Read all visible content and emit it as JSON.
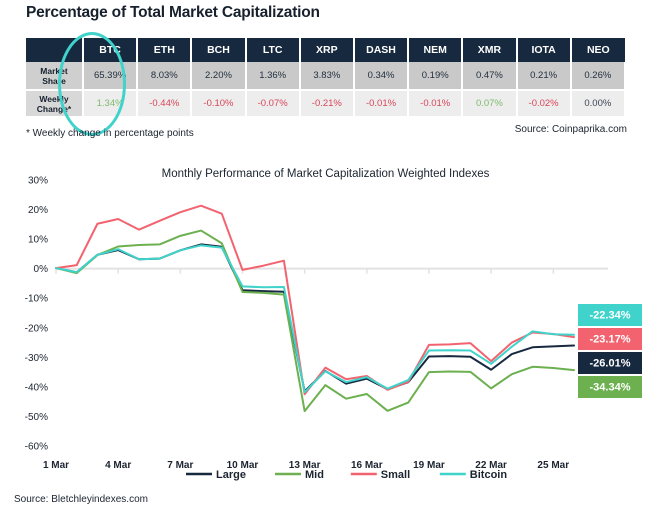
{
  "page_title": "Percentage of Total Market Capitalization",
  "table": {
    "row_header_blank": "",
    "columns": [
      "BTC",
      "ETH",
      "BCH",
      "LTC",
      "XRP",
      "DASH",
      "NEM",
      "XMR",
      "IOTA",
      "NEO"
    ],
    "rows": [
      {
        "label_line1": "Market",
        "label_line2": "Share",
        "values": [
          "65.39%",
          "8.03%",
          "2.20%",
          "1.36%",
          "3.83%",
          "0.34%",
          "0.19%",
          "0.47%",
          "0.21%",
          "0.26%"
        ],
        "signs": [
          "neutral",
          "neutral",
          "neutral",
          "neutral",
          "neutral",
          "neutral",
          "neutral",
          "neutral",
          "neutral",
          "neutral"
        ]
      },
      {
        "label_line1": "Weekly",
        "label_line2": "Change*",
        "values": [
          "1.34%",
          "-0.44%",
          "-0.10%",
          "-0.07%",
          "-0.21%",
          "-0.01%",
          "-0.01%",
          "0.07%",
          "-0.02%",
          "0.00%"
        ],
        "signs": [
          "pos",
          "neg",
          "neg",
          "neg",
          "neg",
          "neg",
          "neg",
          "pos",
          "neg",
          "zero"
        ]
      }
    ],
    "highlight_column": "BTC",
    "highlight_color": "#3fd3cb",
    "header_bg": "#17293f",
    "footnote": "* Weekly change in percentage points",
    "source": "Source: Coinpaprika.com"
  },
  "chart_data": {
    "type": "line",
    "title": "Monthly Performance of Market Capitalization Weighted Indexes",
    "xlabel": "",
    "ylabel": "",
    "ylim": [
      -60,
      30
    ],
    "ytick_labels": [
      "30%",
      "20%",
      "10%",
      "0%",
      "-10%",
      "-20%",
      "-30%",
      "-40%",
      "-50%",
      "-60%"
    ],
    "ytick_values": [
      30,
      20,
      10,
      0,
      -10,
      -20,
      -30,
      -40,
      -50,
      -60
    ],
    "xtick_labels": [
      "1 Mar",
      "4 Mar",
      "7 Mar",
      "10 Mar",
      "13 Mar",
      "16 Mar",
      "19 Mar",
      "22 Mar",
      "25 Mar"
    ],
    "xtick_indices": [
      0,
      3,
      6,
      9,
      12,
      15,
      18,
      21,
      24
    ],
    "grid": "zero-line-only",
    "legend_position": "bottom",
    "x": [
      "1 Mar",
      "2 Mar",
      "3 Mar",
      "4 Mar",
      "5 Mar",
      "6 Mar",
      "7 Mar",
      "8 Mar",
      "9 Mar",
      "10 Mar",
      "11 Mar",
      "12 Mar",
      "13 Mar",
      "14 Mar",
      "15 Mar",
      "16 Mar",
      "17 Mar",
      "18 Mar",
      "19 Mar",
      "20 Mar",
      "21 Mar",
      "22 Mar",
      "23 Mar",
      "24 Mar",
      "25 Mar",
      "26 Mar"
    ],
    "series": [
      {
        "name": "Large",
        "color": "#17293f",
        "end_label": "-26.01%",
        "end_label_bg": "#17293f",
        "values": [
          0.2,
          -1.2,
          4.7,
          6.3,
          3.2,
          3.4,
          6.2,
          8.2,
          7.4,
          -7.3,
          -7.6,
          -7.8,
          -41.5,
          -34.6,
          -38.9,
          -37.2,
          -40.8,
          -38.4,
          -29.7,
          -29.6,
          -29.8,
          -34.2,
          -28.9,
          -26.6,
          -26.3,
          -26.01
        ]
      },
      {
        "name": "Mid",
        "color": "#6cb04f",
        "end_label": "-34.34%",
        "end_label_bg": "#6cb04f",
        "values": [
          0.2,
          -1.5,
          4.6,
          7.5,
          8.0,
          8.2,
          11.1,
          12.9,
          8.6,
          -7.9,
          -8.2,
          -8.8,
          -48.2,
          -39.4,
          -44.0,
          -42.4,
          -48.1,
          -45.3,
          -35.0,
          -34.8,
          -34.9,
          -40.5,
          -35.7,
          -33.2,
          -33.6,
          -34.34
        ]
      },
      {
        "name": "Small",
        "color": "#f2636f",
        "end_label": "-23.17%",
        "end_label_bg": "#f2636f",
        "values": [
          0.2,
          1.2,
          15.2,
          16.8,
          13.2,
          16.2,
          19.1,
          21.3,
          18.6,
          -0.4,
          1.0,
          2.7,
          -42.5,
          -33.5,
          -37.4,
          -36.3,
          -41.0,
          -38.3,
          -25.8,
          -25.6,
          -25.2,
          -31.3,
          -25.0,
          -21.6,
          -22.1,
          -23.17
        ]
      },
      {
        "name": "Bitcoin",
        "color": "#3fd3cb",
        "end_label": "-22.34%",
        "end_label_bg": "#3fd3cb",
        "values": [
          0.2,
          -1.2,
          4.7,
          6.6,
          3.2,
          3.4,
          6.2,
          7.9,
          7.1,
          -6.0,
          -6.3,
          -6.2,
          -41.8,
          -34.7,
          -38.4,
          -36.7,
          -40.6,
          -37.7,
          -27.7,
          -27.6,
          -27.7,
          -32.2,
          -26.4,
          -21.2,
          -22.2,
          -22.34
        ]
      }
    ],
    "legend": [
      {
        "name": "Large",
        "color": "#17293f"
      },
      {
        "name": "Mid",
        "color": "#6cb04f"
      },
      {
        "name": "Small",
        "color": "#f2636f"
      },
      {
        "name": "Bitcoin",
        "color": "#3fd3cb"
      }
    ],
    "source": "Source: Bletchleyindexes.com"
  }
}
